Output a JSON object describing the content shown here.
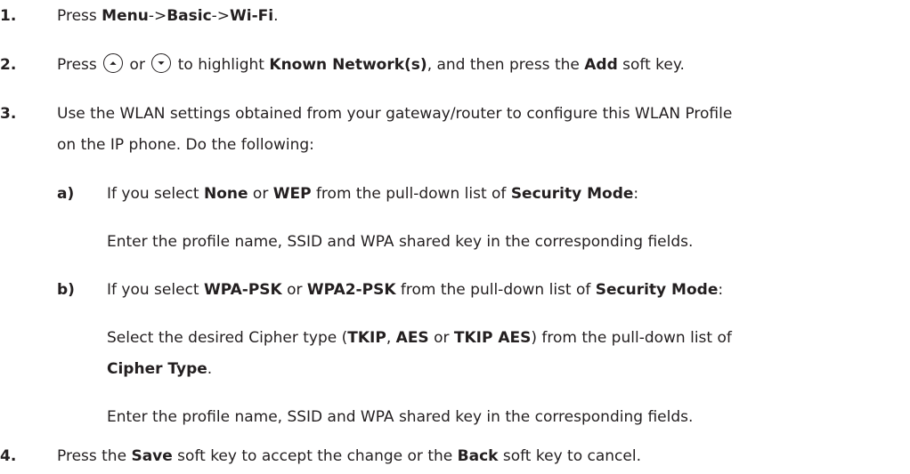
{
  "steps": [
    {
      "number": "1.",
      "parts": [
        "Press ",
        "Menu",
        "->",
        "Basic",
        "->",
        "Wi-Fi",
        "."
      ]
    },
    {
      "number": "2.",
      "parts": [
        "Press ",
        " or ",
        " to highlight ",
        "Known Network(s)",
        ", and then press the ",
        "Add",
        " soft key."
      ]
    },
    {
      "number": "3.",
      "line1": "Use the WLAN settings obtained from your gateway/router to configure this WLAN Profile",
      "line2": "on the IP phone. Do the following:",
      "substeps": [
        {
          "number": "a)",
          "parts": [
            "If you select ",
            "None",
            " or ",
            "WEP",
            " from the pull-down list of ",
            "Security Mode",
            ":"
          ],
          "detail": "Enter the profile name, SSID and WPA shared key in the corresponding fields."
        },
        {
          "number": "b)",
          "parts": [
            "If you select ",
            "WPA-PSK",
            " or ",
            "WPA2-PSK",
            " from the pull-down list of ",
            "Security Mode",
            ":"
          ],
          "cipher_parts": [
            "Select the desired Cipher type (",
            "TKIP",
            ", ",
            "AES",
            " or ",
            "TKIP AES",
            ") from the pull-down list of"
          ],
          "cipher_line2": [
            "Cipher Type",
            "."
          ],
          "detail": "Enter the profile name, SSID and WPA shared key in the corresponding fields."
        }
      ]
    },
    {
      "number": "4.",
      "parts": [
        "Press the ",
        "Save",
        " soft key to accept the change or the ",
        "Back",
        " soft key to cancel."
      ]
    }
  ],
  "icons": {
    "up": "up-arrow-key-icon",
    "down": "down-arrow-key-icon"
  }
}
